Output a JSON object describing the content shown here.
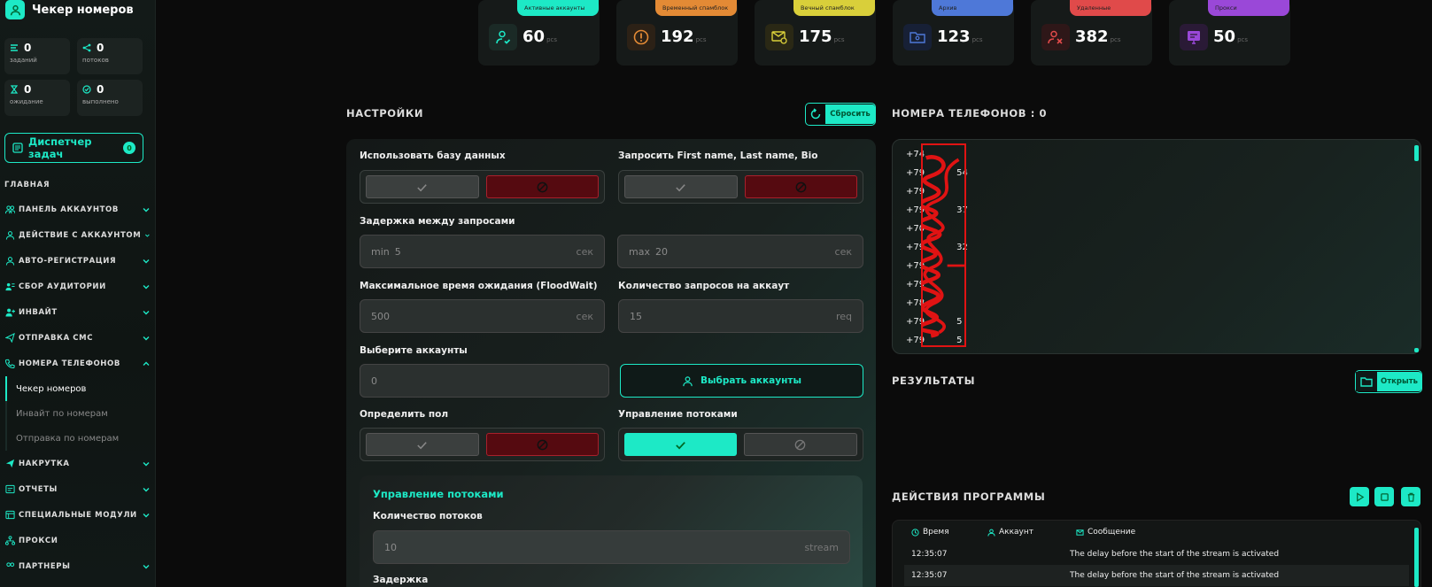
{
  "app": {
    "title": "Чекер номеров"
  },
  "sidebar": {
    "stats": [
      {
        "value": "0",
        "label": "заданий"
      },
      {
        "value": "0",
        "label": "потоков"
      },
      {
        "value": "0",
        "label": "ожидание"
      },
      {
        "value": "0",
        "label": "выполнено"
      }
    ],
    "dispatcher": {
      "label": "Диспетчер задач",
      "badge": "0"
    },
    "section": "ГЛАВНАЯ",
    "nav": [
      {
        "label": "ПАНЕЛЬ АККАУНТОВ",
        "icon": "users-icon"
      },
      {
        "label": "ДЕЙСТВИЕ С АККАУНТОМ",
        "icon": "user-icon"
      },
      {
        "label": "АВТО-РЕГИСТРАЦИЯ",
        "icon": "user-icon"
      },
      {
        "label": "СБОР АУДИТОРИИ",
        "icon": "user-card-icon"
      },
      {
        "label": "ИНВАЙТ",
        "icon": "user-plus-icon"
      },
      {
        "label": "ОТПРАВКА СМС",
        "icon": "send-icon"
      },
      {
        "label": "НОМЕРА ТЕЛЕФОНОВ",
        "icon": "phone-icon"
      }
    ],
    "sub": [
      "Чекер номеров",
      "Инвайт по номерам",
      "Отправка по номерам"
    ],
    "nav2": [
      {
        "label": "НАКРУТКА",
        "icon": "send-icon"
      },
      {
        "label": "ОТЧЕТЫ",
        "icon": "report-icon"
      },
      {
        "label": "СПЕЦИАЛЬНЫЕ МОДУЛИ",
        "icon": "modules-icon"
      },
      {
        "label": "ПРОКСИ",
        "icon": "proxy-icon"
      },
      {
        "label": "ПАРТНЕРЫ",
        "icon": "partners-icon"
      }
    ]
  },
  "cards": [
    {
      "tag": "Активные аккаунты",
      "value": "60",
      "unit": "pcs",
      "color": "#1de9c6"
    },
    {
      "tag": "Временный спамблок",
      "value": "192",
      "unit": "pcs",
      "color": "#e38a35"
    },
    {
      "tag": "Вечный спамблок",
      "value": "175",
      "unit": "pcs",
      "color": "#d9cf3a"
    },
    {
      "tag": "Архив",
      "value": "123",
      "unit": "pcs",
      "color": "#4e78d8"
    },
    {
      "tag": "Удаленные",
      "value": "382",
      "unit": "pcs",
      "color": "#e04a4a"
    },
    {
      "tag": "Прокси",
      "value": "50",
      "unit": "pcs",
      "color": "#9a48d8"
    }
  ],
  "settings": {
    "title": "НАСТРОЙКИ",
    "reset": "Сбросить",
    "use_db": "Использовать базу данных",
    "request_names": "Запросить First name, Last name, Bio",
    "delay_label": "Задержка между запросами",
    "delay_min_prefix": "min",
    "delay_min": "5",
    "delay_max_prefix": "max",
    "delay_max": "20",
    "unit_sec": "сек",
    "floodwait_label": "Максимальное время ожидания (FloodWait)",
    "floodwait": "500",
    "req_label": "Количество запросов на аккаут",
    "req_placeholder": "15",
    "req_unit": "req",
    "accounts_label": "Выберите аккаунты",
    "accounts_value": "0",
    "accounts_button": "Выбрать аккаунты",
    "gender_label": "Определить пол",
    "threads_label": "Управление потоками",
    "sub_title": "Управление потоками",
    "thread_count_label": "Количество потоков",
    "thread_count": "10",
    "thread_unit": "stream",
    "delay2_label": "Задержка"
  },
  "phones": {
    "title": "НОМЕРА ТЕЛЕФОНОВ : 0",
    "rows": [
      "+74",
      "+79",
      "+79",
      "+79",
      "+70",
      "+79",
      "+79",
      "+79",
      "+78",
      "+79",
      "+79"
    ],
    "row_suffix": [
      "",
      "54",
      "",
      "37",
      "",
      "32",
      "",
      "",
      "",
      "5",
      "5"
    ]
  },
  "results": {
    "title": "РЕЗУЛЬТАТЫ",
    "open": "Открыть"
  },
  "actions": {
    "title": "ДЕЙСТВИЯ ПРОГРАММЫ",
    "cols": [
      "Время",
      "Аккаунт",
      "Сообщение"
    ],
    "rows": [
      {
        "time": "12:35:07",
        "account": "",
        "message": "The delay before the start of the stream is activated"
      },
      {
        "time": "12:35:07",
        "account": "",
        "message": "The delay before the start of the stream is activated"
      }
    ]
  }
}
